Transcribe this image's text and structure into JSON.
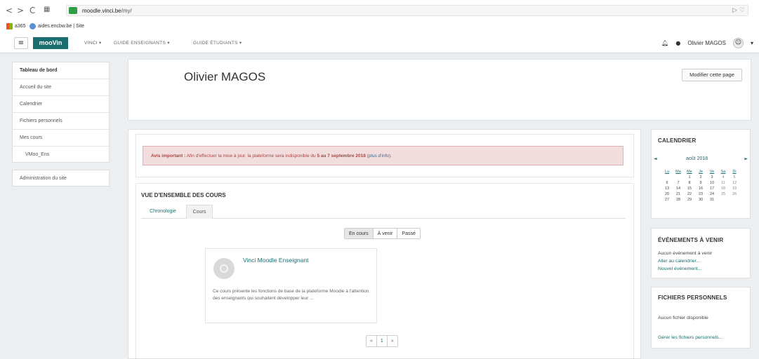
{
  "browser": {
    "url_host": "moodle.vinci.be",
    "url_path": "/my/",
    "bookmarks": [
      "a365",
      "aides.encbw.be | Site"
    ],
    "right_icons": "▷ ♡"
  },
  "navbar": {
    "brand": "mooVin",
    "links": [
      "VINCI ▾",
      "GUIDE ENSEIGNANTS ▾",
      "GUIDE ÉTUDIANTS ▾"
    ],
    "user": "Olivier MAGOS",
    "caret": "▾"
  },
  "sidebar": {
    "items": [
      "Tableau de bord",
      "Accueil du site",
      "Calendrier",
      "Fichiers personnels",
      "Mes cours",
      "VMoo_Ens"
    ],
    "admin": "Administration du site"
  },
  "header": {
    "title": "Olivier MAGOS",
    "edit_button": "Modifier cette page"
  },
  "notice": {
    "lead": "Avis important :",
    "text": " Afin d'effectuer la mise à jour, la plateforme sera indisponible du ",
    "dates": "5 au 7 septembre 2018",
    "open": " (",
    "link": "plus d'info",
    "close": ")."
  },
  "overview": {
    "title": "VUE D'ENSEMBLE DES COURS",
    "tabs": [
      "Chronologie",
      "Cours"
    ],
    "filters": [
      "En cours",
      "À venir",
      "Passé"
    ],
    "course": {
      "title": "Vinci Moodle Enseignant",
      "description": "Ce cours présente les fonctions de base de la plateforme Moodle à l'attention des enseignants qui souhaitent développer leur ..."
    },
    "pager": [
      "«",
      "1",
      "»"
    ]
  },
  "calendar": {
    "title": "CALENDRIER",
    "month": "août 2018",
    "prev": "◄",
    "next": "►",
    "weekdays": [
      "Lu",
      "Ma",
      "Me",
      "Je",
      "Ve",
      "Sa",
      "Di"
    ],
    "weeks": [
      [
        "",
        "",
        "1",
        "2",
        "3",
        "4",
        "5"
      ],
      [
        "6",
        "7",
        "8",
        "9",
        "10",
        "11",
        "12"
      ],
      [
        "13",
        "14",
        "15",
        "16",
        "17",
        "18",
        "19"
      ],
      [
        "20",
        "21",
        "22",
        "23",
        "24",
        "25",
        "26"
      ],
      [
        "27",
        "28",
        "29",
        "30",
        "31",
        "",
        ""
      ]
    ]
  },
  "events": {
    "title": "ÉVÉNEMENTS À VENIR",
    "none": "Aucun événement à venir",
    "link_calendar": "Aller au calendrier...",
    "link_new": "Nouvel événement..."
  },
  "files": {
    "title": "FICHIERS PERSONNELS",
    "none": "Aucun fichier disponible",
    "link_manage": "Gérer les fichiers personnels..."
  },
  "colors": {
    "brand": "#1a6e6e",
    "alert_bg": "#f2dede",
    "alert_text": "#a94442"
  }
}
